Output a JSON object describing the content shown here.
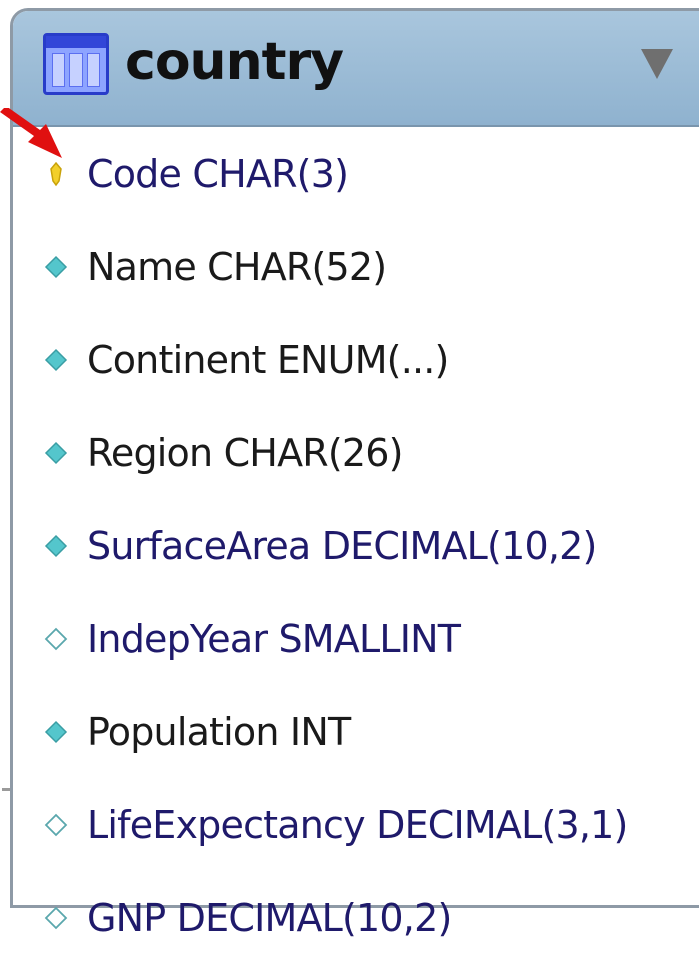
{
  "table": {
    "name": "country",
    "icon": "table-icon",
    "toggle_icon": "collapse-triangle-icon"
  },
  "columns": [
    {
      "label": "Code CHAR(3)",
      "icon": "primary-key-icon",
      "color": "#1f1a6b"
    },
    {
      "label": "Name CHAR(52)",
      "icon": "not-null-column-icon",
      "color": "#1a1a1a"
    },
    {
      "label": "Continent ENUM(...)",
      "icon": "not-null-column-icon",
      "color": "#1a1a1a"
    },
    {
      "label": "Region CHAR(26)",
      "icon": "not-null-column-icon",
      "color": "#1a1a1a"
    },
    {
      "label": "SurfaceArea DECIMAL(10,2)",
      "icon": "not-null-column-icon",
      "color": "#1f1a6b"
    },
    {
      "label": "IndepYear SMALLINT",
      "icon": "nullable-column-icon",
      "color": "#1f1a6b"
    },
    {
      "label": "Population INT",
      "icon": "not-null-column-icon",
      "color": "#1a1a1a"
    },
    {
      "label": "LifeExpectancy DECIMAL(3,1)",
      "icon": "nullable-column-icon",
      "color": "#1f1a6b"
    },
    {
      "label": "GNP DECIMAL(10,2)",
      "icon": "nullable-column-icon",
      "color": "#1f1a6b"
    }
  ],
  "colors": {
    "header": "#9fbdd6",
    "key": "#f2cf2a",
    "not_null": "#54c6cc",
    "nullable": "#ffffff",
    "annotation_arrow": "#e01010"
  }
}
